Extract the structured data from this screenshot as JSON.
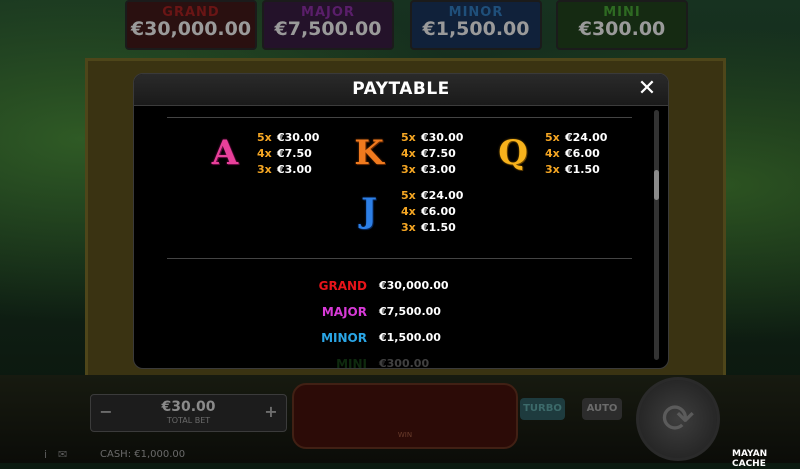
{
  "background": {
    "jackpots": [
      {
        "name": "GRAND",
        "value": "€30,000.00"
      },
      {
        "name": "MAJOR",
        "value": "€7,500.00"
      },
      {
        "name": "MINOR",
        "value": "€1,500.00"
      },
      {
        "name": "MINI",
        "value": "€300.00"
      }
    ],
    "bet": {
      "minus": "−",
      "plus": "+",
      "value": "€30.00",
      "label": "TOTAL BET"
    },
    "win_label": "WIN",
    "turbo_label": "TURBO",
    "auto_label": "AUTO",
    "spin_glyph": "⟳",
    "cash": "CASH: €1,000.00",
    "info_icon": "i",
    "mail_icon": "✉",
    "game_title": "MAYAN CACHE"
  },
  "modal": {
    "title": "PAYTABLE",
    "close_icon": "✕",
    "symbols": [
      {
        "letter": "A",
        "pays": [
          {
            "count": "5x",
            "amount": "€30.00"
          },
          {
            "count": "4x",
            "amount": "€7.50"
          },
          {
            "count": "3x",
            "amount": "€3.00"
          }
        ]
      },
      {
        "letter": "K",
        "pays": [
          {
            "count": "5x",
            "amount": "€30.00"
          },
          {
            "count": "4x",
            "amount": "€7.50"
          },
          {
            "count": "3x",
            "amount": "€3.00"
          }
        ]
      },
      {
        "letter": "Q",
        "pays": [
          {
            "count": "5x",
            "amount": "€24.00"
          },
          {
            "count": "4x",
            "amount": "€6.00"
          },
          {
            "count": "3x",
            "amount": "€1.50"
          }
        ]
      },
      {
        "letter": "J",
        "pays": [
          {
            "count": "5x",
            "amount": "€24.00"
          },
          {
            "count": "4x",
            "amount": "€6.00"
          },
          {
            "count": "3x",
            "amount": "€1.50"
          }
        ]
      }
    ],
    "jackpots": [
      {
        "name": "GRAND",
        "amount": "€30,000.00",
        "color": "#e8141a"
      },
      {
        "name": "MAJOR",
        "amount": "€7,500.00",
        "color": "#d83ad8"
      },
      {
        "name": "MINOR",
        "amount": "€1,500.00",
        "color": "#2aa6e6"
      },
      {
        "name": "MINI",
        "amount": "€300.00",
        "color": "#3aa83a"
      }
    ]
  }
}
